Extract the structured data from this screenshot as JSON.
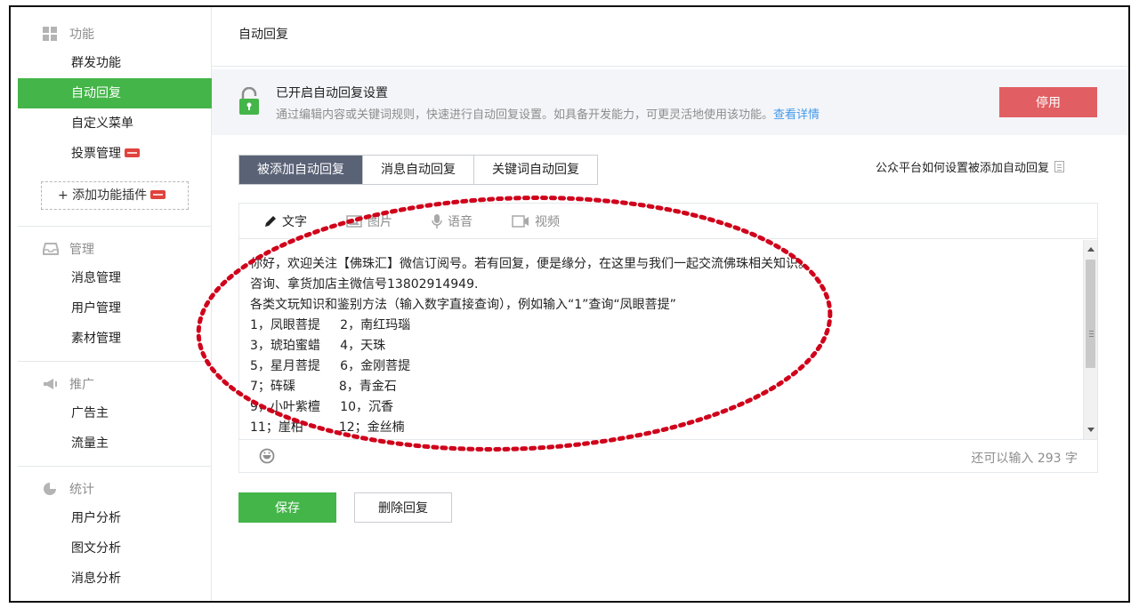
{
  "sidebar": {
    "groups": [
      {
        "title": "功能",
        "icon": "grid-icon",
        "items": [
          {
            "label": "群发功能"
          },
          {
            "label": "自动回复",
            "active": true
          },
          {
            "label": "自定义菜单"
          },
          {
            "label": "投票管理",
            "badge": true
          }
        ]
      },
      {
        "title": "管理",
        "icon": "inbox-icon",
        "items": [
          {
            "label": "消息管理"
          },
          {
            "label": "用户管理"
          },
          {
            "label": "素材管理"
          }
        ]
      },
      {
        "title": "推广",
        "icon": "megaphone-icon",
        "items": [
          {
            "label": "广告主"
          },
          {
            "label": "流量主"
          }
        ]
      },
      {
        "title": "统计",
        "icon": "pie-chart-icon",
        "items": [
          {
            "label": "用户分析"
          },
          {
            "label": "图文分析"
          },
          {
            "label": "消息分析"
          }
        ]
      }
    ],
    "add_plugin": "+ 添加功能插件"
  },
  "main": {
    "page_title": "自动回复",
    "status": {
      "title": "已开启自动回复设置",
      "desc": "通过编辑内容或关键词规则，快速进行自动回复设置。如具备开发能力，可更灵活地使用该功能。",
      "link": "查看详情",
      "disable_label": "停用"
    },
    "tabs": [
      "被添加自动回复",
      "消息自动回复",
      "关键词自动回复"
    ],
    "help_link": "公众平台如何设置被添加自动回复",
    "toolbar": [
      "文字",
      "图片",
      "语音",
      "视频"
    ],
    "content_lines": [
      "你好，欢迎关注【佛珠汇】微信订阅号。若有回复，便是缘分，在这里与我们一起交流佛珠相关知识。",
      "咨询、拿货加店主微信号13802914949.",
      "各类文玩知识和鉴别方法（输入数字直接查询），例如输入“1”查询“凤眼菩提”",
      "1，凤眼菩提     2，南红玛瑙",
      "3，琥珀蜜蜡     4，天珠",
      "5，星月菩提     6，金刚菩提",
      "7；砗磲           8，青金石",
      "9，小叶紫檀     10，沉香",
      "11；崖柏         12；金丝楠"
    ],
    "char_count": "还可以输入 293 字",
    "save_label": "保存",
    "delete_label": "删除回复"
  },
  "colors": {
    "brand_green": "#44b549",
    "danger_red": "#e15f63",
    "active_tab": "#5a6276",
    "link_blue": "#459ae9",
    "annotation_red": "#d0021b"
  }
}
